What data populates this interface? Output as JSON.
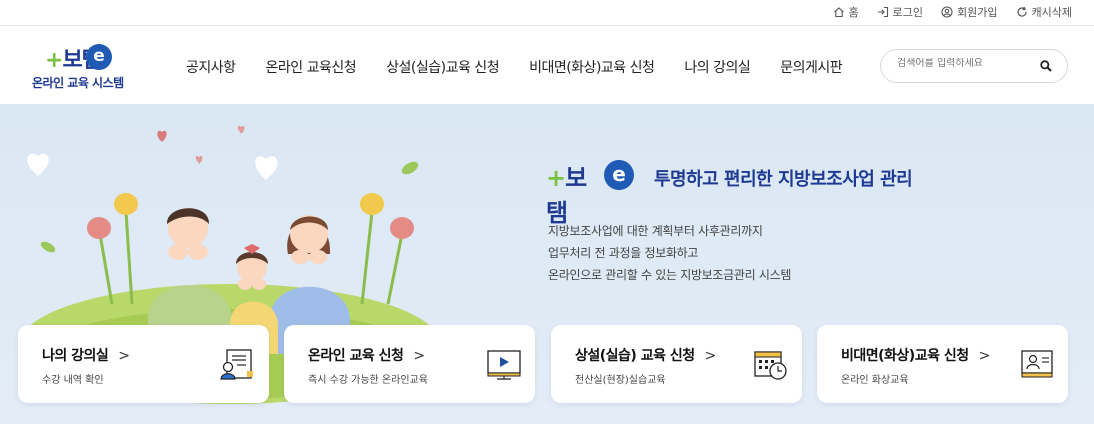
{
  "util_links": [
    {
      "label": "홈",
      "icon": "home-icon"
    },
    {
      "label": "로그인",
      "icon": "login-icon"
    },
    {
      "label": "회원가입",
      "icon": "user-circle-icon"
    },
    {
      "label": "캐시삭제",
      "icon": "refresh-icon"
    }
  ],
  "logo": {
    "mark": "보탬",
    "e": "e",
    "sub": "온라인 교육 시스템"
  },
  "nav": [
    "공지사항",
    "온라인 교육신청",
    "상설(실습)교육 신청",
    "비대면(화상)교육 신청",
    "나의 강의실",
    "문의게시판"
  ],
  "search": {
    "placeholder": "검색어를 입력하세요"
  },
  "hero": {
    "brand": "보탬",
    "brand_e": "e",
    "tagline": "투명하고 편리한 지방보조사업 관리",
    "desc": [
      "지방보조사업에 대한 계획부터 사후관리까지",
      "업무처리 전 과정을 정보화하고",
      "온라인으로 관리할 수 있는 지방보조금관리 시스템"
    ]
  },
  "cards": [
    {
      "title": "나의 강의실",
      "chevron": ">",
      "sub": "수강 내역 확인",
      "icon": "certificate-icon"
    },
    {
      "title": "온라인 교육 신청",
      "chevron": ">",
      "sub": "즉시 수강 가능한 온라인교육",
      "icon": "video-monitor-icon"
    },
    {
      "title": "상설(실습) 교육 신청",
      "chevron": ">",
      "sub": "전산실(현장)실습교육",
      "icon": "calendar-clock-icon"
    },
    {
      "title": "비대면(화상)교육 신청",
      "chevron": ">",
      "sub": "온라인 화상교육",
      "icon": "video-call-icon"
    }
  ],
  "colors": {
    "brand_navy": "#1f3a93",
    "brand_green": "#7cc242",
    "brand_blue": "#1f5bb5",
    "hero_bg": "#dae8f4"
  }
}
